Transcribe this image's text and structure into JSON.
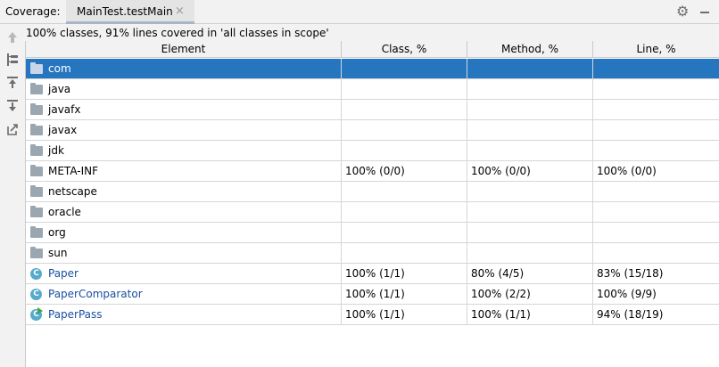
{
  "window": {
    "label": "Coverage:",
    "tab_title": "MainTest.testMain",
    "tab_close": "×",
    "settings_icon": "gear-icon",
    "minimize_icon": "minimize-icon"
  },
  "sidebar": {
    "icons": [
      "rerun-icon",
      "flatten-packages-icon",
      "generate-report-icon",
      "import-report-icon",
      "export-icon"
    ]
  },
  "summary": "100% classes, 91% lines covered in 'all classes in scope'",
  "table": {
    "columns": [
      "Element",
      "Class, %",
      "Method, %",
      "Line, %"
    ],
    "rows": [
      {
        "type": "package",
        "name": "com",
        "class": "",
        "method": "",
        "line": "",
        "selected": true
      },
      {
        "type": "package",
        "name": "java",
        "class": "",
        "method": "",
        "line": ""
      },
      {
        "type": "package",
        "name": "javafx",
        "class": "",
        "method": "",
        "line": ""
      },
      {
        "type": "package",
        "name": "javax",
        "class": "",
        "method": "",
        "line": ""
      },
      {
        "type": "package",
        "name": "jdk",
        "class": "",
        "method": "",
        "line": ""
      },
      {
        "type": "package",
        "name": "META-INF",
        "class": "100% (0/0)",
        "method": "100% (0/0)",
        "line": "100% (0/0)"
      },
      {
        "type": "package",
        "name": "netscape",
        "class": "",
        "method": "",
        "line": ""
      },
      {
        "type": "package",
        "name": "oracle",
        "class": "",
        "method": "",
        "line": ""
      },
      {
        "type": "package",
        "name": "org",
        "class": "",
        "method": "",
        "line": ""
      },
      {
        "type": "package",
        "name": "sun",
        "class": "",
        "method": "",
        "line": ""
      },
      {
        "type": "class",
        "name": "Paper",
        "class": "100% (1/1)",
        "method": "80% (4/5)",
        "line": "83% (15/18)"
      },
      {
        "type": "class",
        "name": "PaperComparator",
        "class": "100% (1/1)",
        "method": "100% (2/2)",
        "line": "100% (9/9)"
      },
      {
        "type": "runnable-class",
        "name": "PaperPass",
        "class": "100% (1/1)",
        "method": "100% (1/1)",
        "line": "94% (18/19)"
      }
    ]
  },
  "colors": {
    "selection": "#2675bf",
    "class_icon": "#56aacb",
    "class_name": "#1a4fa0",
    "folder": "#9aa7b0"
  }
}
